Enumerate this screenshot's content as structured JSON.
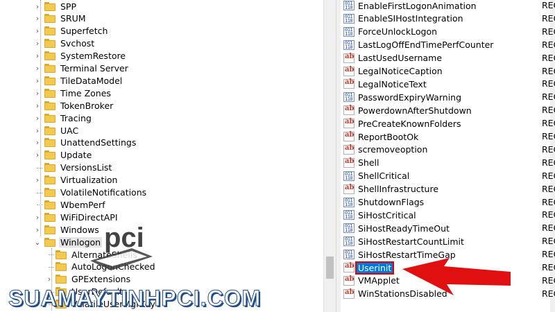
{
  "tree": {
    "items": [
      {
        "label": "SPP",
        "expander": "›"
      },
      {
        "label": "SRUM",
        "expander": "›"
      },
      {
        "label": "Superfetch",
        "expander": "›"
      },
      {
        "label": "Svchost",
        "expander": "›"
      },
      {
        "label": "SystemRestore",
        "expander": "›"
      },
      {
        "label": "Terminal Server",
        "expander": "›"
      },
      {
        "label": "TileDataModel",
        "expander": "›"
      },
      {
        "label": "Time Zones",
        "expander": "›"
      },
      {
        "label": "TokenBroker",
        "expander": "›"
      },
      {
        "label": "Tracing",
        "expander": "›"
      },
      {
        "label": "UAC",
        "expander": "›"
      },
      {
        "label": "UnattendSettings",
        "expander": "›"
      },
      {
        "label": "Update",
        "expander": "›"
      },
      {
        "label": "VersionsList",
        "expander": ""
      },
      {
        "label": "Virtualization",
        "expander": "›"
      },
      {
        "label": "VolatileNotifications",
        "expander": ""
      },
      {
        "label": "WbemPerf",
        "expander": ""
      },
      {
        "label": "WiFiDirectAPI",
        "expander": "›"
      },
      {
        "label": "Windows",
        "expander": "›"
      },
      {
        "label": "Winlogon",
        "expander": "⌄"
      }
    ],
    "children": [
      {
        "label": "AlternateShells",
        "expander": ""
      },
      {
        "label": "AutoLogonChecked",
        "expander": ""
      },
      {
        "label": "GPExtensions",
        "expander": "›"
      },
      {
        "label": "UserDefaults",
        "expander": ""
      },
      {
        "label": "VolatileUserMgrKey",
        "expander": ""
      }
    ]
  },
  "values": {
    "type_label": "REG",
    "items": [
      {
        "name": "EnableFirstLogonAnimation",
        "icon": "binary-value-icon"
      },
      {
        "name": "EnableSIHostIntegration",
        "icon": "binary-value-icon"
      },
      {
        "name": "ForceUnlockLogon",
        "icon": "binary-value-icon"
      },
      {
        "name": "LastLogOffEndTimePerfCounter",
        "icon": "binary-value-icon"
      },
      {
        "name": "LastUsedUsername",
        "icon": "string-value-icon"
      },
      {
        "name": "LegalNoticeCaption",
        "icon": "string-value-icon"
      },
      {
        "name": "LegalNoticeText",
        "icon": "string-value-icon"
      },
      {
        "name": "PasswordExpiryWarning",
        "icon": "binary-value-icon"
      },
      {
        "name": "PowerdownAfterShutdown",
        "icon": "string-value-icon"
      },
      {
        "name": "PreCreateKnownFolders",
        "icon": "string-value-icon"
      },
      {
        "name": "ReportBootOk",
        "icon": "string-value-icon"
      },
      {
        "name": "scremoveoption",
        "icon": "string-value-icon"
      },
      {
        "name": "Shell",
        "icon": "string-value-icon"
      },
      {
        "name": "ShellCritical",
        "icon": "binary-value-icon"
      },
      {
        "name": "ShellInfrastructure",
        "icon": "string-value-icon"
      },
      {
        "name": "ShutdownFlags",
        "icon": "binary-value-icon"
      },
      {
        "name": "SiHostCritical",
        "icon": "binary-value-icon"
      },
      {
        "name": "SiHostReadyTimeOut",
        "icon": "binary-value-icon"
      },
      {
        "name": "SiHostRestartCountLimit",
        "icon": "binary-value-icon"
      },
      {
        "name": "SiHostRestartTimeGap",
        "icon": "binary-value-icon"
      },
      {
        "name": "Userinit",
        "icon": "string-value-icon",
        "selected": true
      },
      {
        "name": "VMApplet",
        "icon": "string-value-icon"
      },
      {
        "name": "WinStationsDisabled",
        "icon": "string-value-icon"
      }
    ]
  },
  "icons": {
    "string_glyph": "ab",
    "binary_glyph": "011\n110"
  },
  "watermark": {
    "text": "SUAMAYTINH",
    "brand": "PCI",
    "suffix": ".COM",
    "logo_text": "pci"
  },
  "colors": {
    "selection": "#0078d7",
    "arrow": "#e01010",
    "folder": "#f3c94e"
  }
}
